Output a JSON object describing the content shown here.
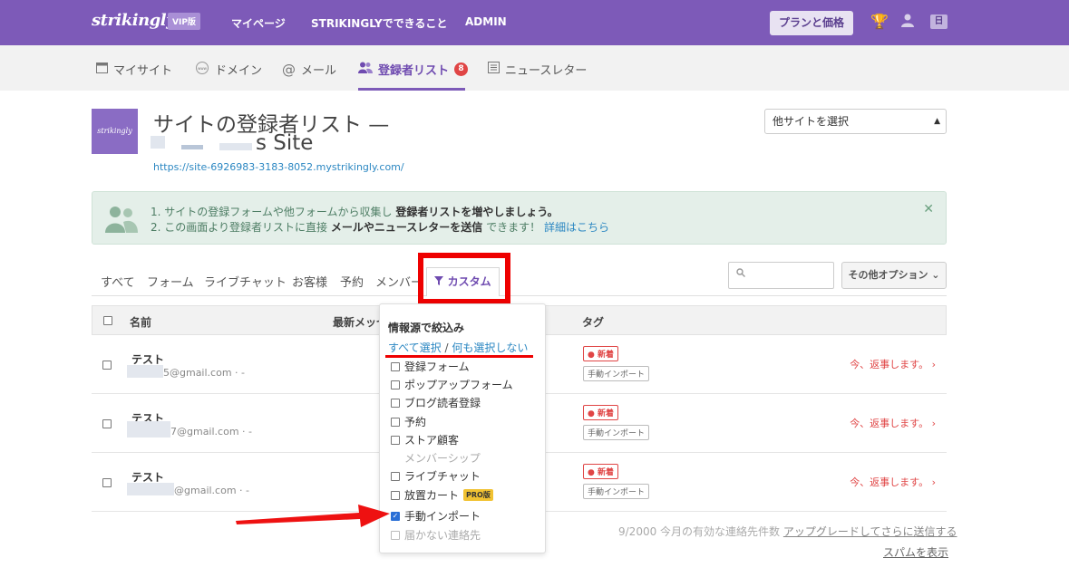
{
  "header": {
    "logo": "strikingly",
    "vip": "VIP版",
    "nav": [
      "マイページ",
      "STRIKINGLYでできること",
      "ADMIN"
    ],
    "plan_button": "プランと価格",
    "lang": "日"
  },
  "subnav": {
    "items": [
      {
        "label": "マイサイト",
        "icon": "window-icon"
      },
      {
        "label": "ドメイン",
        "icon": "www-icon"
      },
      {
        "label": "メール",
        "icon": "at-icon"
      },
      {
        "label": "登録者リスト",
        "icon": "people-icon",
        "badge": "8"
      },
      {
        "label": "ニュースレター",
        "icon": "newsletter-icon"
      }
    ]
  },
  "site": {
    "thumb": "strikingly",
    "title_line1": "サイトの登録者リスト —",
    "title_line2": "s Site",
    "url": "https://site-6926983-3183-8052.mystrikingly.com/",
    "select": "他サイトを選択"
  },
  "banner": {
    "l1_pre": "1. サイトの登録フォームや他フォームから収集し",
    "l1_bold": "登録者リストを増やしましょう。",
    "l2_pre": "2. この画面より登録者リストに直接",
    "l2_bold": "メールやニュースレターを送信",
    "l2_post": "できます！",
    "l2_link": "詳細はこちら",
    "close": "✕"
  },
  "tabs": [
    "すべて",
    "フォーム",
    "ライブチャット",
    "お客様",
    "予約",
    "メンバー",
    "カスタム"
  ],
  "options_button": "その他オプション ⌄",
  "table": {
    "headers": [
      "名前",
      "最新メッセ",
      "タグ"
    ],
    "rows": [
      {
        "name": "テスト",
        "email": "5@gmail.com · -",
        "tag_new": "● 新着",
        "tag_import": "手動インポート",
        "reply": "今、返事します。"
      },
      {
        "name": "テスト",
        "email": "7@gmail.com · -",
        "tag_new": "● 新着",
        "tag_import": "手動インポート",
        "reply": "今、返事します。"
      },
      {
        "name": "テスト",
        "email": "@gmail.com · -",
        "tag_new": "● 新着",
        "tag_import": "手動インポート",
        "reply": "今、返事します。"
      }
    ]
  },
  "footer": {
    "count": "9/2000 今月の有効な連絡先件数",
    "upgrade": "アップグレードしてさらに送信する",
    "spam": "スパムを表示"
  },
  "dropdown": {
    "title": "情報源で絞込み",
    "select_all": "すべて選択",
    "sep": "/",
    "select_none": "何も選択しない",
    "items": [
      {
        "label": "登録フォーム",
        "checked": false,
        "checkbox": true
      },
      {
        "label": "ポップアップフォーム",
        "checked": false,
        "checkbox": true
      },
      {
        "label": "ブログ読者登録",
        "checked": false,
        "checkbox": true
      },
      {
        "label": "予約",
        "checked": false,
        "checkbox": true
      },
      {
        "label": "ストア顧客",
        "checked": false,
        "checkbox": true
      },
      {
        "label": "メンバーシップ",
        "checked": false,
        "checkbox": false
      },
      {
        "label": "ライブチャット",
        "checked": false,
        "checkbox": true
      },
      {
        "label": "放置カート",
        "checked": false,
        "checkbox": true,
        "pro": "PRO版"
      },
      {
        "label": "手動インポート",
        "checked": true,
        "checkbox": true
      },
      {
        "label": "届かない連絡先",
        "checked": false,
        "checkbox": true,
        "dim": true
      }
    ]
  },
  "colors": {
    "brand": "#7d5ab8",
    "accent_red": "#e04545",
    "link": "#2b87c2",
    "annotation": "#ee0000"
  }
}
